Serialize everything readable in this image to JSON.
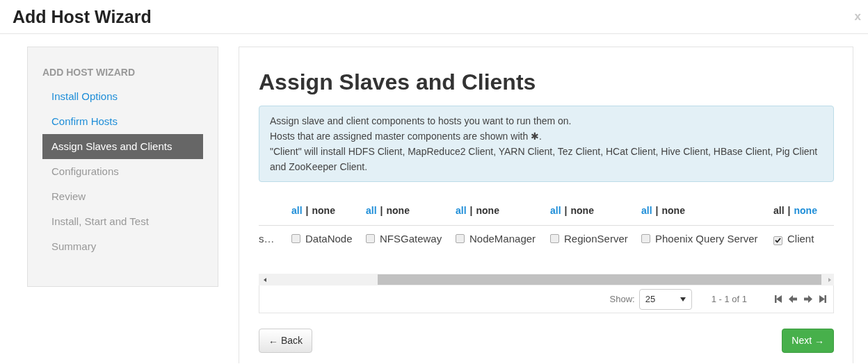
{
  "window": {
    "title": "Add Host Wizard",
    "close": "x"
  },
  "sidebar": {
    "heading": "ADD HOST WIZARD",
    "items": [
      {
        "label": "Install Options",
        "completed": true,
        "selected": false
      },
      {
        "label": "Confirm Hosts",
        "completed": true,
        "selected": false
      },
      {
        "label": "Assign Slaves and Clients",
        "selected": true
      },
      {
        "label": "Configurations",
        "completed": false,
        "selected": false
      },
      {
        "label": "Review",
        "completed": false,
        "selected": false
      },
      {
        "label": "Install, Start and Test",
        "completed": false,
        "selected": false
      },
      {
        "label": "Summary",
        "completed": false,
        "selected": false
      }
    ]
  },
  "page": {
    "title": "Assign Slaves and Clients",
    "info": [
      "Assign slave and client components to hosts you want to run them on.",
      "Hosts that are assigned master components are shown with ✱.",
      "\"Client\" will install HDFS Client, MapReduce2 Client, YARN Client, Tez Client, HCat Client, Hive Client, HBase Client, Pig Client and ZooKeeper Client."
    ]
  },
  "table": {
    "columns": [
      {
        "all": "all",
        "separator": "|",
        "none": "none",
        "all_link": true,
        "none_link": false
      },
      {
        "all": "all",
        "separator": "|",
        "none": "none",
        "all_link": true,
        "none_link": false
      },
      {
        "all": "all",
        "separator": "|",
        "none": "none",
        "all_link": true,
        "none_link": false
      },
      {
        "all": "all",
        "separator": "|",
        "none": "none",
        "all_link": true,
        "none_link": false
      },
      {
        "all": "all",
        "separator": "|",
        "none": "none",
        "all_link": true,
        "none_link": false
      },
      {
        "all": "all",
        "separator": "|",
        "none": "none",
        "all_link": false,
        "none_link": true
      }
    ],
    "rows": [
      {
        "host": "s…",
        "components": [
          {
            "label": "DataNode",
            "checked": false
          },
          {
            "label": "NFSGateway",
            "checked": false
          },
          {
            "label": "NodeManager",
            "checked": false
          },
          {
            "label": "RegionServer",
            "checked": false
          },
          {
            "label": "Phoenix Query Server",
            "checked": false
          },
          {
            "label": "Client",
            "checked": true
          }
        ]
      }
    ],
    "pager": {
      "show_label": "Show:",
      "page_size": "25",
      "range": "1 - 1 of 1"
    }
  },
  "buttons": {
    "back": "← Back",
    "next": "Next →"
  }
}
